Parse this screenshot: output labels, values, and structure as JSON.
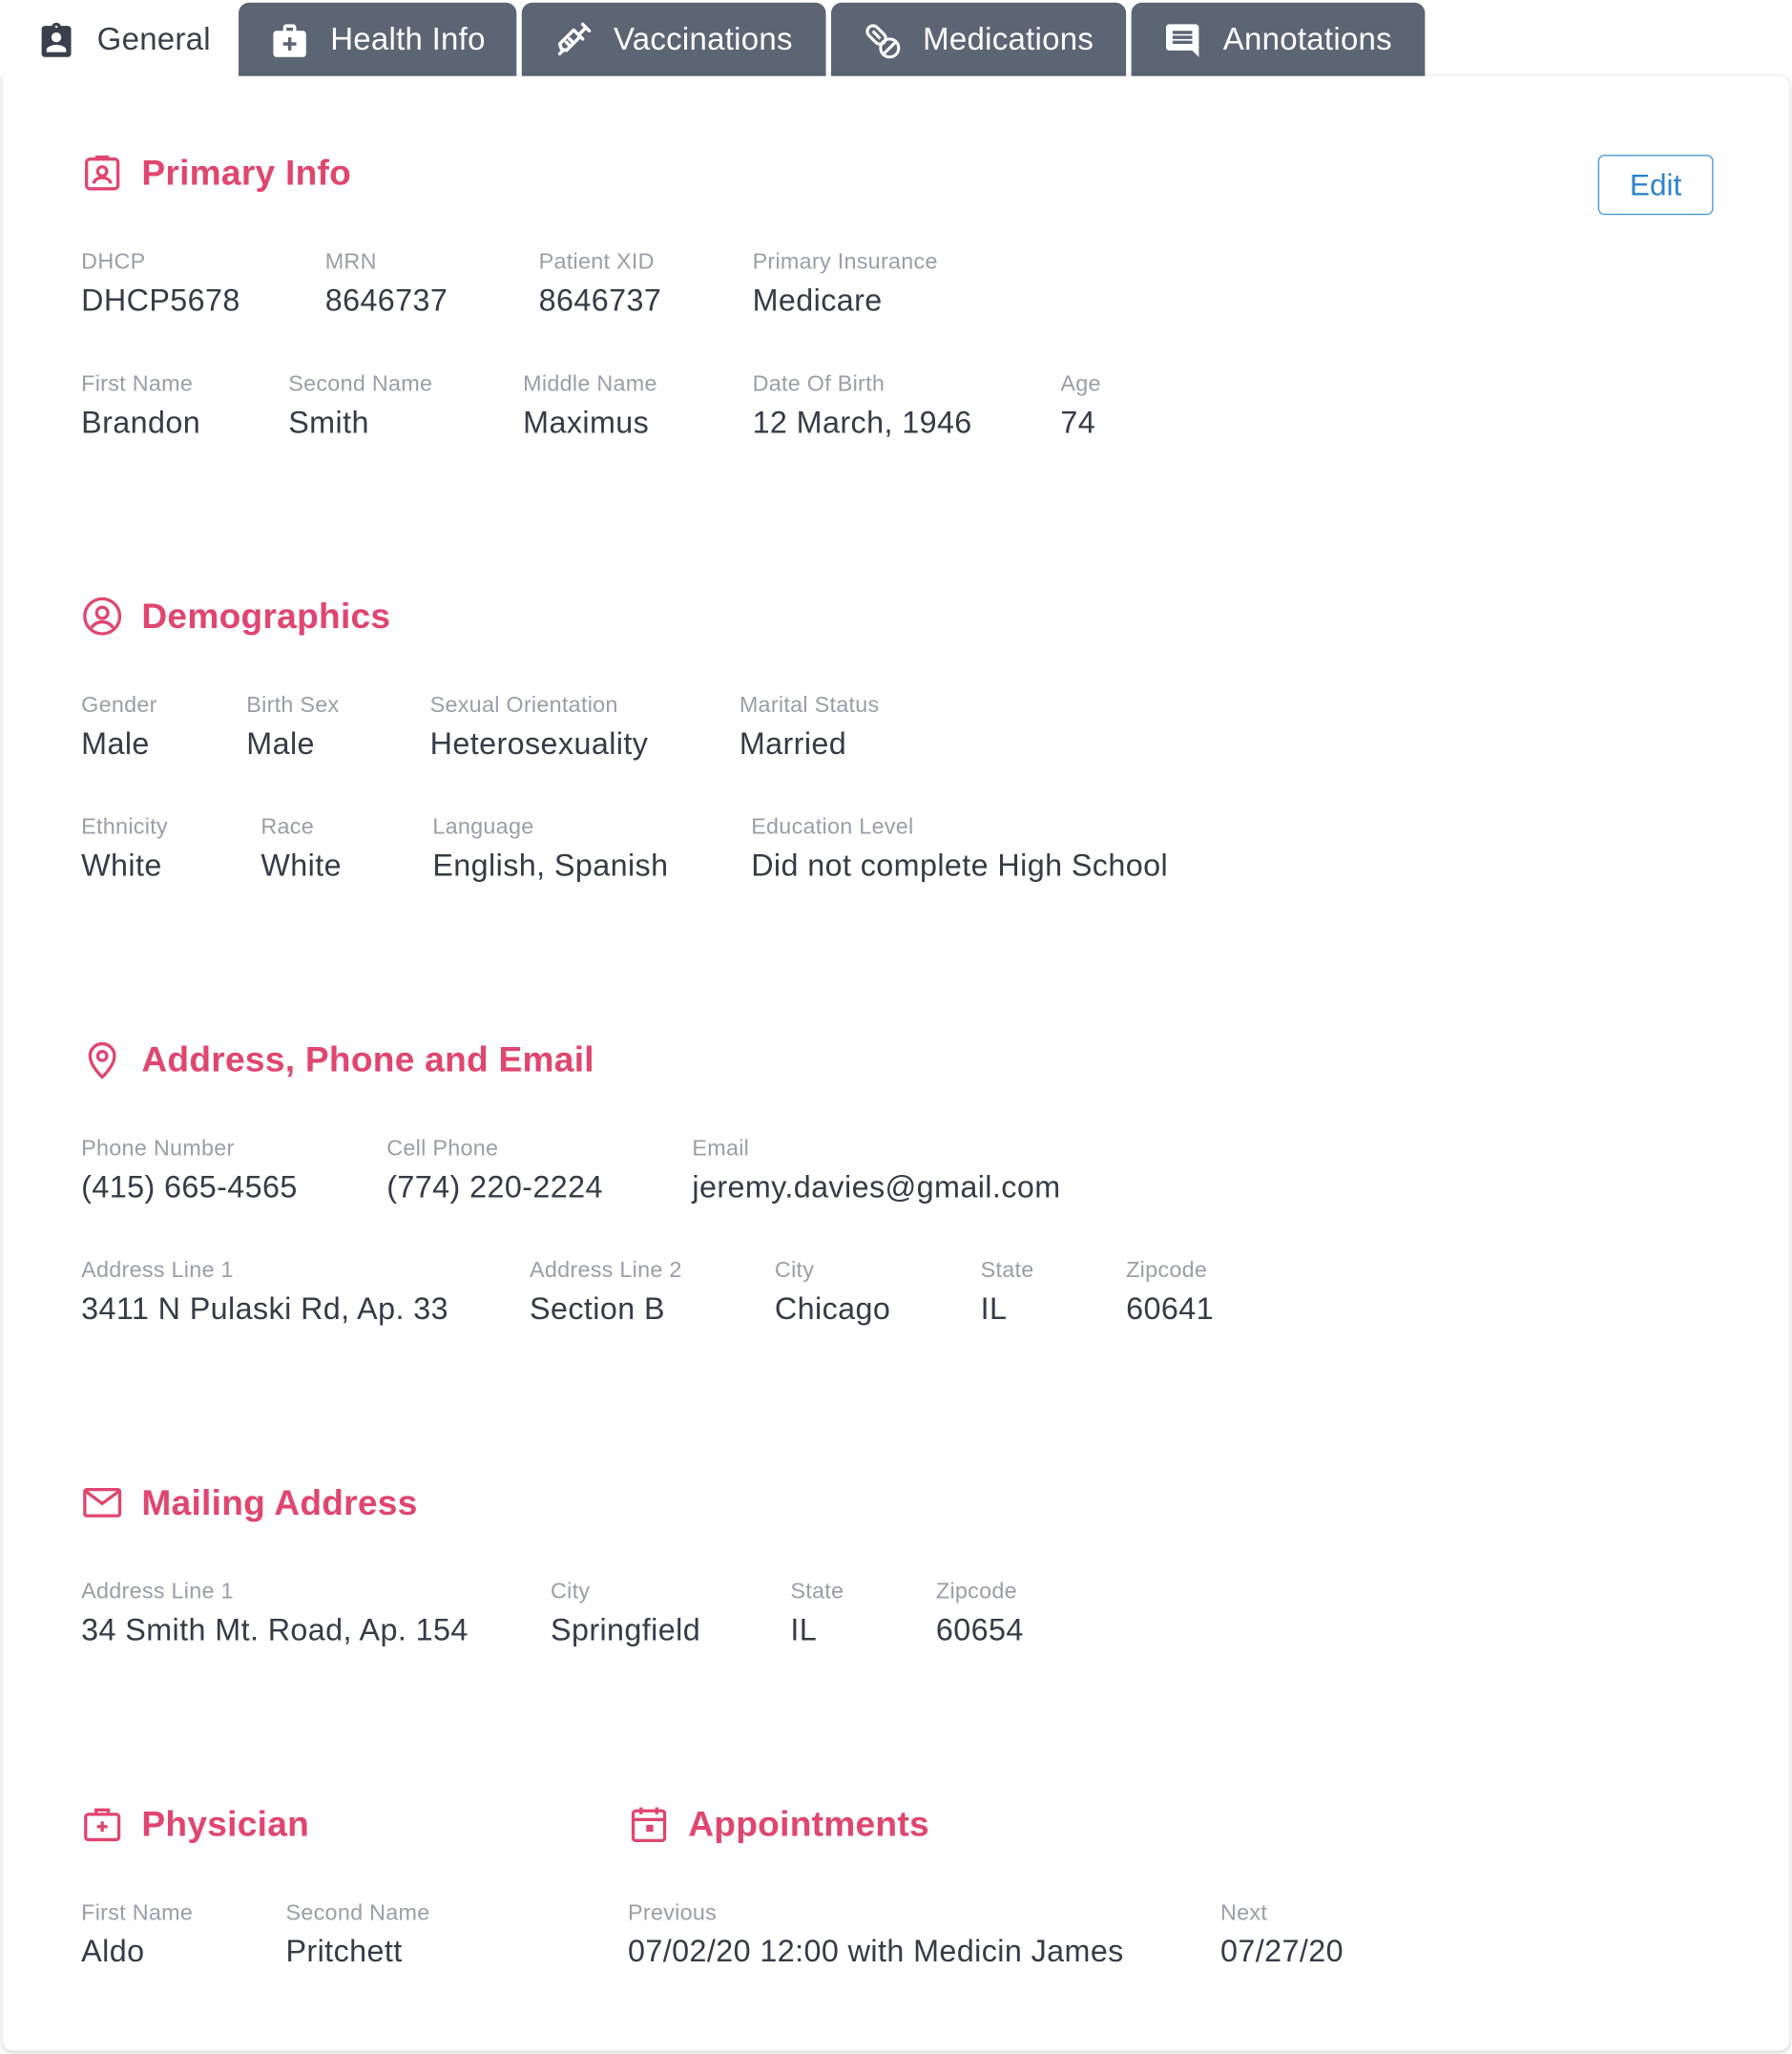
{
  "tabs": [
    {
      "label": "General",
      "icon": "badge-icon"
    },
    {
      "label": "Health Info",
      "icon": "medical-kit-icon"
    },
    {
      "label": "Vaccinations",
      "icon": "syringe-icon"
    },
    {
      "label": "Medications",
      "icon": "pills-icon"
    },
    {
      "label": "Annotations",
      "icon": "comment-icon"
    }
  ],
  "edit_label": "Edit",
  "colors": {
    "accent": "#e0466f",
    "tab_bg": "#5c6574",
    "link": "#2f83c9"
  },
  "primary_info": {
    "title": "Primary Info",
    "icon": "id-badge-icon",
    "dhcp": {
      "label": "DHCP",
      "value": "DHCP5678"
    },
    "mrn": {
      "label": "MRN",
      "value": "8646737"
    },
    "patient_xid": {
      "label": "Patient XID",
      "value": "8646737"
    },
    "primary_insurance": {
      "label": "Primary Insurance",
      "value": "Medicare"
    },
    "first_name": {
      "label": "First Name",
      "value": "Brandon"
    },
    "second_name": {
      "label": "Second Name",
      "value": "Smith"
    },
    "middle_name": {
      "label": "Middle Name",
      "value": "Maximus"
    },
    "date_of_birth": {
      "label": "Date Of Birth",
      "value": "12 March, 1946"
    },
    "age": {
      "label": "Age",
      "value": "74"
    }
  },
  "demographics": {
    "title": "Demographics",
    "icon": "user-circle-icon",
    "gender": {
      "label": "Gender",
      "value": "Male"
    },
    "birth_sex": {
      "label": "Birth Sex",
      "value": "Male"
    },
    "sexual_orientation": {
      "label": "Sexual Orientation",
      "value": "Heterosexuality"
    },
    "marital_status": {
      "label": "Marital Status",
      "value": "Married"
    },
    "ethnicity": {
      "label": "Ethnicity",
      "value": "White"
    },
    "race": {
      "label": "Race",
      "value": "White"
    },
    "language": {
      "label": "Language",
      "value": "English, Spanish"
    },
    "education_level": {
      "label": "Education Level",
      "value": "Did not complete High School"
    }
  },
  "contact": {
    "title": "Address, Phone and Email",
    "icon": "location-pin-icon",
    "phone": {
      "label": "Phone Number",
      "value": "(415) 665-4565"
    },
    "cell": {
      "label": "Cell Phone",
      "value": "(774) 220-2224"
    },
    "email": {
      "label": "Email",
      "value": "jeremy.davies@gmail.com"
    },
    "address1": {
      "label": "Address Line 1",
      "value": "3411 N Pulaski Rd, Ap. 33"
    },
    "address2": {
      "label": "Address Line 2",
      "value": "Section B"
    },
    "city": {
      "label": "City",
      "value": "Chicago"
    },
    "state": {
      "label": "State",
      "value": "IL"
    },
    "zipcode": {
      "label": "Zipcode",
      "value": "60641"
    }
  },
  "mailing": {
    "title": "Mailing Address",
    "icon": "envelope-icon",
    "address1": {
      "label": "Address Line 1",
      "value": "34 Smith Mt. Road, Ap. 154"
    },
    "city": {
      "label": "City",
      "value": "Springfield"
    },
    "state": {
      "label": "State",
      "value": "IL"
    },
    "zipcode": {
      "label": "Zipcode",
      "value": "60654"
    }
  },
  "physician": {
    "title": "Physician",
    "icon": "medical-case-icon",
    "first_name": {
      "label": "First Name",
      "value": "Aldo"
    },
    "second_name": {
      "label": "Second Name",
      "value": "Pritchett"
    }
  },
  "appointments": {
    "title": "Appointments",
    "icon": "calendar-icon",
    "previous": {
      "label": "Previous",
      "value": "07/02/20 12:00 with Medicin James"
    },
    "next": {
      "label": "Next",
      "value": "07/27/20"
    }
  }
}
